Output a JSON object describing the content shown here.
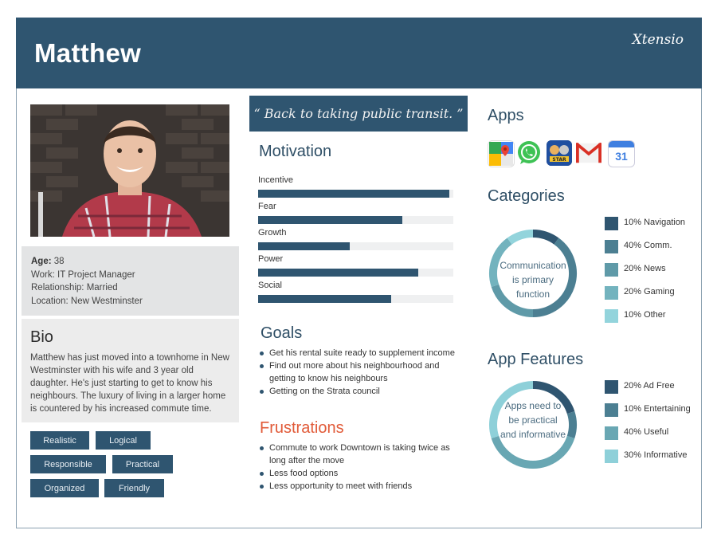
{
  "header": {
    "name": "Matthew",
    "logo": "Xtensio"
  },
  "profile": {
    "age_label": "Age:",
    "age": "38",
    "work_label": "Work:",
    "work": "IT Project Manager",
    "relationship_label": "Relationship:",
    "relationship": "Married",
    "location_label": "Location:",
    "location": "New Westminster"
  },
  "bio": {
    "title": "Bio",
    "text": "Matthew has just moved into a townhome in New Westminster with his wife and 3 year old daughter. He's just starting to get to know his neighbours. The luxury of living in a larger home is countered by his increased commute time."
  },
  "traits": [
    "Realistic",
    "Logical",
    "Responsible",
    "Practical",
    "Organized",
    "Friendly"
  ],
  "quote": "“ Back to taking public transit. ”",
  "motivation": {
    "title": "Motivation",
    "items": [
      {
        "label": "Incentive",
        "value": 0.98
      },
      {
        "label": "Fear",
        "value": 0.74
      },
      {
        "label": "Growth",
        "value": 0.47
      },
      {
        "label": "Power",
        "value": 0.82
      },
      {
        "label": "Social",
        "value": 0.68
      }
    ]
  },
  "goals": {
    "title": "Goals",
    "items": [
      "Get his rental suite ready to supplement income",
      "Find out more about his neighbourhood and getting to know his neighbours",
      "Getting on the Strata council"
    ]
  },
  "frustrations": {
    "title": "Frustrations",
    "items": [
      "Commute to work Downtown is taking twice as long after the move",
      "Less food options",
      "Less opportunity to meet with friends"
    ]
  },
  "apps": {
    "title": "Apps",
    "icons": [
      "google-maps-icon",
      "whatsapp-icon",
      "star-wars-game-icon",
      "gmail-icon",
      "google-calendar-icon"
    ],
    "calendar_day": "31"
  },
  "categories": {
    "title": "Categories",
    "center_text": [
      "Communication",
      "is primary",
      "function"
    ],
    "items": [
      {
        "pct": "10%",
        "label": "Navigation",
        "value": 10,
        "color": "#2f5570"
      },
      {
        "pct": "40%",
        "label": "Comm.",
        "value": 40,
        "color": "#4c7f92"
      },
      {
        "pct": "20%",
        "label": "News",
        "value": 20,
        "color": "#5f9aa8"
      },
      {
        "pct": "20%",
        "label": "Gaming",
        "value": 20,
        "color": "#73b3be"
      },
      {
        "pct": "10%",
        "label": "Other",
        "value": 10,
        "color": "#93d4dc"
      }
    ]
  },
  "features": {
    "title": "App Features",
    "center_text": [
      "Apps need to",
      "be practical",
      "and informative"
    ],
    "items": [
      {
        "pct": "20%",
        "label": "Ad Free",
        "value": 20,
        "color": "#2f5570"
      },
      {
        "pct": "10%",
        "label": "Entertaining",
        "value": 10,
        "color": "#4c7f92"
      },
      {
        "pct": "40%",
        "label": "Useful",
        "value": 40,
        "color": "#69a7b3"
      },
      {
        "pct": "30%",
        "label": "Informative",
        "value": 30,
        "color": "#8ed0d9"
      }
    ]
  }
}
